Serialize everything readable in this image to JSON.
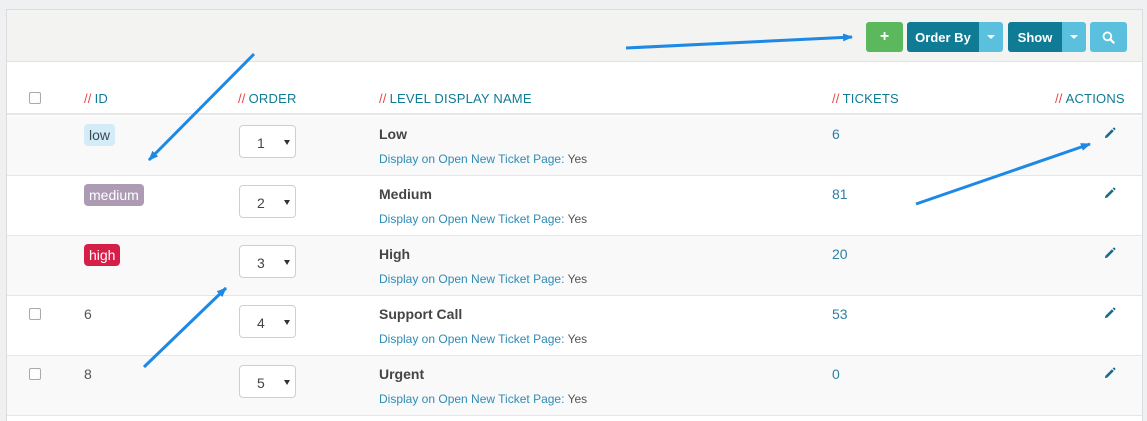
{
  "toolbar": {
    "add_label": "+",
    "order_by_label": "Order By",
    "show_label": "Show"
  },
  "table": {
    "headers": {
      "id": "ID",
      "order": "ORDER",
      "level_display_name": "LEVEL DISPLAY NAME",
      "tickets": "TICKETS",
      "actions": "ACTIONS"
    },
    "header_prefix": "//",
    "display_label": "Display on Open New Ticket Page:",
    "rows": [
      {
        "id": "low",
        "badge": true,
        "order": "1",
        "name": "Low",
        "display_value": "Yes",
        "tickets": "6"
      },
      {
        "id": "medium",
        "badge": true,
        "order": "2",
        "name": "Medium",
        "display_value": "Yes",
        "tickets": "81"
      },
      {
        "id": "high",
        "badge": true,
        "order": "3",
        "name": "High",
        "display_value": "Yes",
        "tickets": "20"
      },
      {
        "id": "6",
        "badge": false,
        "order": "4",
        "name": "Support Call",
        "display_value": "Yes",
        "tickets": "53"
      },
      {
        "id": "8",
        "badge": false,
        "order": "5",
        "name": "Urgent",
        "display_value": "Yes",
        "tickets": "0"
      }
    ]
  },
  "colors": {
    "accent": "#0f7b94",
    "add_button": "#5cb85c",
    "caret_button": "#5bc0de",
    "header_slash": "#e0474c",
    "badge_low_bg": "#d4ecf7",
    "badge_medium_bg": "#ad9bb4",
    "badge_high_bg": "#d61f48",
    "annotation_arrow": "#1e88e5"
  }
}
